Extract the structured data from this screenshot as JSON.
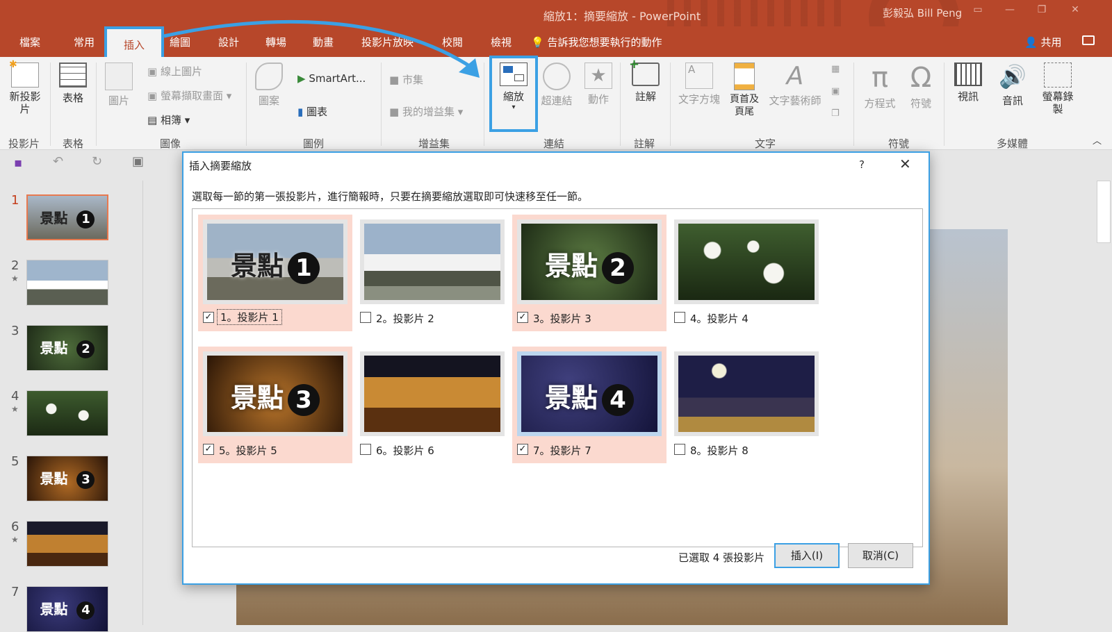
{
  "window": {
    "title": "縮放1：摘要縮放 - PowerPoint",
    "user": "彭毅弘 Bill Peng"
  },
  "tabs": {
    "file": "檔案",
    "home": "常用",
    "insert": "插入",
    "draw": "繪圖",
    "design": "設計",
    "transitions": "轉場",
    "animations": "動畫",
    "slideshow": "投影片放映",
    "review": "校閱",
    "view": "檢視",
    "tell_me": "告訴我您想要執行的動作",
    "share": "共用"
  },
  "ribbon": {
    "new_slide": "新投影片",
    "table": "表格",
    "pictures": "圖片",
    "online_pictures": "線上圖片",
    "screenshot": "螢幕擷取畫面",
    "photo_album": "相簿",
    "shapes": "圖案",
    "smartart": "SmartArt...",
    "chart": "圖表",
    "store": "市集",
    "my_addins": "我的增益集",
    "zoom": "縮放",
    "hyperlink": "超連結",
    "action": "動作",
    "comment": "註解",
    "text_box": "文字方塊",
    "header_footer": "頁首及頁尾",
    "wordart": "文字藝術師",
    "equation": "方程式",
    "symbol": "符號",
    "video": "視訊",
    "audio": "音訊",
    "screen_recording": "螢幕錄製",
    "groups": {
      "slides": "投影片",
      "tables": "表格",
      "images": "圖像",
      "illustrations": "圖例",
      "addins": "增益集",
      "links": "連結",
      "comments": "註解",
      "text": "文字",
      "symbols": "符號",
      "media": "多媒體"
    }
  },
  "thumbnails": [
    {
      "num": "1",
      "star": "",
      "text": "景點",
      "badge": "1"
    },
    {
      "num": "2",
      "star": "★",
      "text": "",
      "badge": ""
    },
    {
      "num": "3",
      "star": "",
      "text": "景點",
      "badge": "2"
    },
    {
      "num": "4",
      "star": "★",
      "text": "",
      "badge": ""
    },
    {
      "num": "5",
      "star": "",
      "text": "景點",
      "badge": "3"
    },
    {
      "num": "6",
      "star": "★",
      "text": "",
      "badge": ""
    },
    {
      "num": "7",
      "star": "",
      "text": "景點",
      "badge": "4"
    }
  ],
  "dialog": {
    "title": "插入摘要縮放",
    "help": "?",
    "close": "✕",
    "instruction": "選取每一節的第一張投影片，進行簡報時，只要在摘要縮放選取即可快速移至任一節。",
    "slides": [
      {
        "label": "1。投影片 1",
        "checked": true,
        "sign": "景點",
        "badge": "1"
      },
      {
        "label": "2。投影片 2",
        "checked": false,
        "sign": "",
        "badge": ""
      },
      {
        "label": "3。投影片 3",
        "checked": true,
        "sign": "景點",
        "badge": "2"
      },
      {
        "label": "4。投影片 4",
        "checked": false,
        "sign": "",
        "badge": ""
      },
      {
        "label": "5。投影片 5",
        "checked": true,
        "sign": "景點",
        "badge": "3"
      },
      {
        "label": "6。投影片 6",
        "checked": false,
        "sign": "",
        "badge": ""
      },
      {
        "label": "7。投影片 7",
        "checked": true,
        "sign": "景點",
        "badge": "4"
      },
      {
        "label": "8。投影片 8",
        "checked": false,
        "sign": "",
        "badge": ""
      }
    ],
    "selected_count": "已選取 4 張投影片",
    "insert_button": "插入(I)",
    "cancel_button": "取消(C)"
  },
  "colors": {
    "accent": "#b7472a",
    "highlight": "#3ba0e4",
    "selected_card": "#fbd9cf"
  }
}
